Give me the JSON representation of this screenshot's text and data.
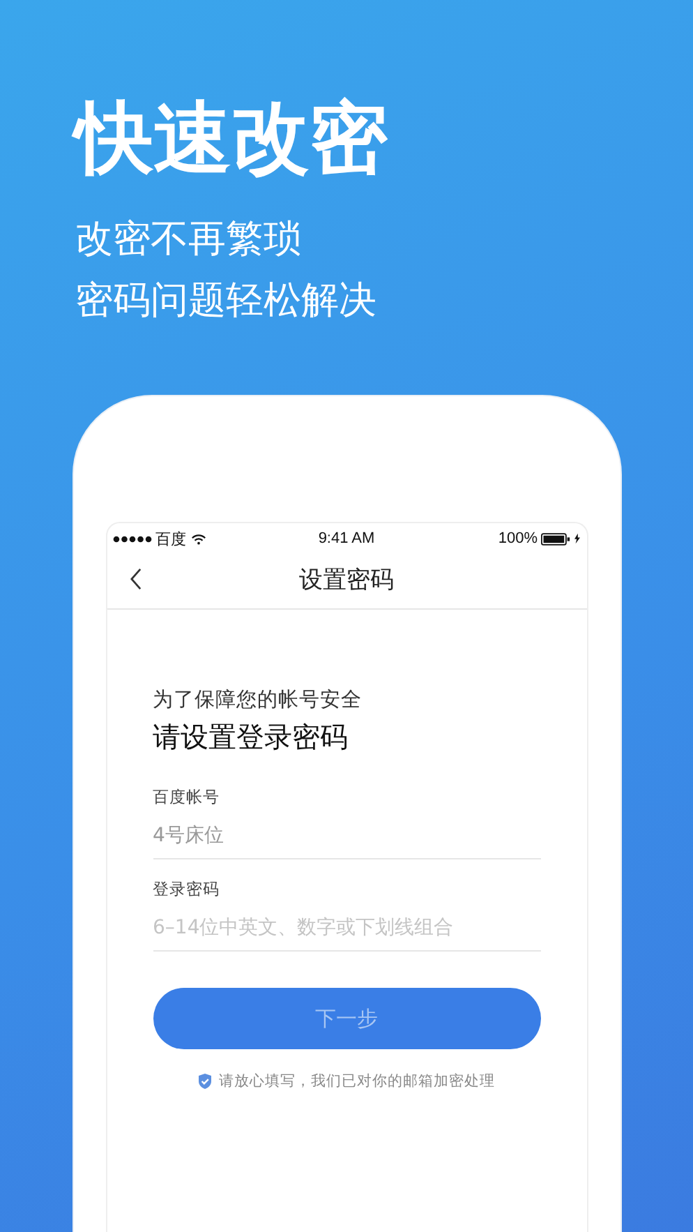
{
  "headline": "快速改密",
  "subtitles": [
    "改密不再繁琐",
    "密码问题轻松解决"
  ],
  "status_bar": {
    "carrier": "百度",
    "time": "9:41 AM",
    "battery": "100%"
  },
  "nav": {
    "title": "设置密码"
  },
  "intro": "为了保障您的帐号安全",
  "heading": "请设置登录密码",
  "fields": [
    {
      "label": "百度帐号",
      "value": "4号床位"
    },
    {
      "label": "登录密码",
      "placeholder": "6–14位中英文、数字或下划线组合"
    }
  ],
  "button": {
    "label": "下一步",
    "disabled": true
  },
  "note": "请放心填写，我们已对你的邮箱加密处理"
}
